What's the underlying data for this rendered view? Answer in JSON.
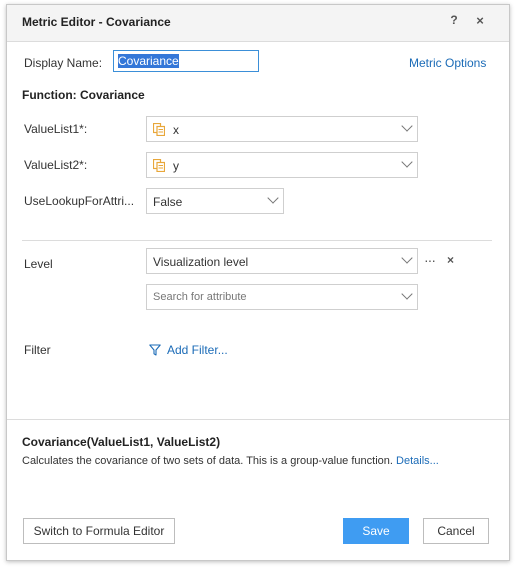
{
  "window": {
    "title": "Metric Editor - Covariance",
    "help_label": "?",
    "close_label": "×"
  },
  "display_name": {
    "label": "Display Name:",
    "value": "Covariance"
  },
  "metric_options_link": "Metric Options",
  "function_title": "Function: Covariance",
  "params": [
    {
      "label": "ValueList1*:",
      "value": "x",
      "icon": "attribute-icon"
    },
    {
      "label": "ValueList2*:",
      "value": "y",
      "icon": "attribute-icon"
    },
    {
      "label": "UseLookupForAttri...",
      "value": "False"
    }
  ],
  "level": {
    "label": "Level",
    "value": "Visualization level",
    "more_label": "···",
    "remove_label": "×",
    "search_placeholder": "Search for attribute"
  },
  "filter": {
    "label": "Filter",
    "add_label": "Add Filter..."
  },
  "signature": "Covariance(ValueList1, ValueList2)",
  "description": "Calculates the covariance of two sets of data. This is a group-value function.",
  "details_link": "Details...",
  "buttons": {
    "formula": "Switch to Formula Editor",
    "save": "Save",
    "cancel": "Cancel"
  },
  "colors": {
    "accent": "#3f9cf2",
    "link": "#1b6bb7",
    "attribute_icon": "#e8a73a"
  }
}
